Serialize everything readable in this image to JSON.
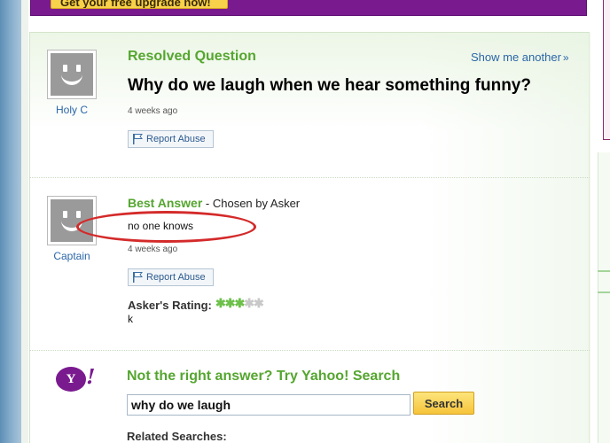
{
  "banner": {
    "upgrade_label": "Get your free upgrade now!"
  },
  "question": {
    "section_title": "Resolved Question",
    "show_another": "Show me another",
    "show_another_arrow": "»",
    "asker": "Holy C",
    "title": "Why do we laugh when we hear something funny?",
    "time": "4 weeks ago",
    "report_label": "Report Abuse"
  },
  "answer": {
    "label": "Best Answer",
    "chosen_by": " - Chosen by Asker",
    "answerer": "Captain",
    "text": "no one knows",
    "time": "4 weeks ago",
    "report_label": "Report Abuse",
    "rating_label": "Asker's Rating:",
    "rating_stars": 3,
    "rating_max": 5,
    "rating_comment": "k",
    "highlight_color": "#d42a2a"
  },
  "search": {
    "logo_text": "Y",
    "logo_bang": "!",
    "title": "Not the right answer? Try Yahoo! Search",
    "query": "why do we laugh",
    "button_label": "Search",
    "related_label": "Related Searches:"
  },
  "colors": {
    "accent_green": "#55a630",
    "link_blue": "#2b67a8",
    "yahoo_purple": "#7a1a8f",
    "button_yellow": "#f6c43a"
  },
  "icons": {
    "avatar": "default-avatar-icon",
    "report": "flag-icon",
    "star": "star-icon"
  }
}
